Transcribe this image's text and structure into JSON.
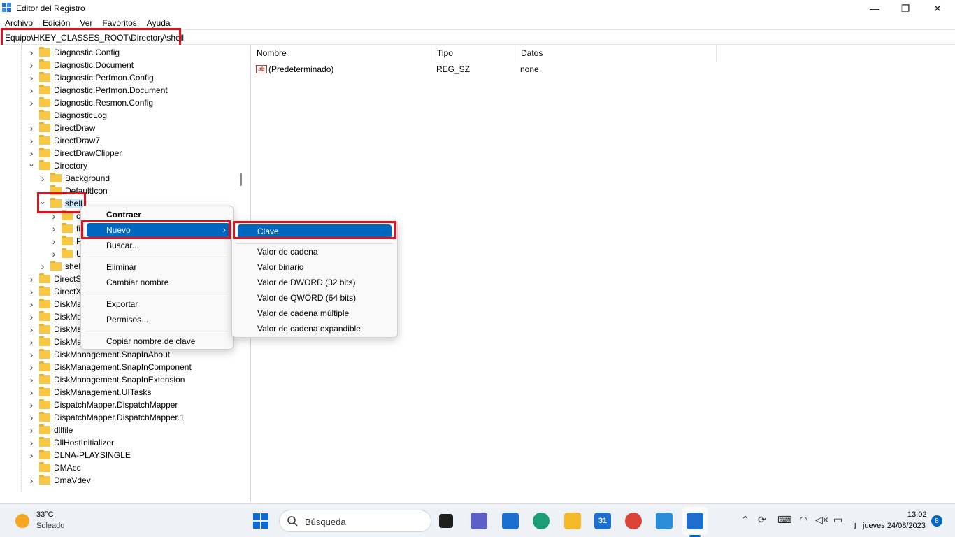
{
  "window": {
    "title": "Editor del Registro",
    "minimize": "—",
    "maximize": "❐",
    "close": "✕"
  },
  "menu": [
    "Archivo",
    "Edición",
    "Ver",
    "Favoritos",
    "Ayuda"
  ],
  "address": "Equipo\\HKEY_CLASSES_ROOT\\Directory\\shell",
  "tree": {
    "rows": [
      {
        "label": "Diagnostic.Config",
        "level": 0,
        "expander": "collapsed"
      },
      {
        "label": "Diagnostic.Document",
        "level": 0,
        "expander": "collapsed"
      },
      {
        "label": "Diagnostic.Perfmon.Config",
        "level": 0,
        "expander": "collapsed"
      },
      {
        "label": "Diagnostic.Perfmon.Document",
        "level": 0,
        "expander": "collapsed"
      },
      {
        "label": "Diagnostic.Resmon.Config",
        "level": 0,
        "expander": "collapsed"
      },
      {
        "label": "DiagnosticLog",
        "level": 0,
        "expander": "none"
      },
      {
        "label": "DirectDraw",
        "level": 0,
        "expander": "collapsed"
      },
      {
        "label": "DirectDraw7",
        "level": 0,
        "expander": "collapsed"
      },
      {
        "label": "DirectDrawClipper",
        "level": 0,
        "expander": "collapsed"
      },
      {
        "label": "Directory",
        "level": 0,
        "expander": "expanded"
      },
      {
        "label": "Background",
        "level": 1,
        "expander": "collapsed"
      },
      {
        "label": "DefaultIcon",
        "level": 1,
        "expander": "none"
      },
      {
        "label": "shell",
        "level": 1,
        "expander": "expanded",
        "selected": true
      },
      {
        "label": "cı",
        "level": 2,
        "expander": "collapsed"
      },
      {
        "label": "fi",
        "level": 2,
        "expander": "collapsed"
      },
      {
        "label": "P",
        "level": 2,
        "expander": "collapsed"
      },
      {
        "label": "U",
        "level": 2,
        "expander": "collapsed"
      },
      {
        "label": "shell",
        "level": 1,
        "expander": "collapsed"
      },
      {
        "label": "DirectSh",
        "level": 0,
        "expander": "collapsed"
      },
      {
        "label": "DirectXl",
        "level": 0,
        "expander": "collapsed"
      },
      {
        "label": "DiskMa",
        "level": 0,
        "expander": "collapsed"
      },
      {
        "label": "DiskMa",
        "level": 0,
        "expander": "collapsed"
      },
      {
        "label": "DiskMa",
        "level": 0,
        "expander": "collapsed"
      },
      {
        "label": "DiskMa",
        "level": 0,
        "expander": "collapsed"
      },
      {
        "label": "DiskManagement.SnapInAbout",
        "level": 0,
        "expander": "collapsed"
      },
      {
        "label": "DiskManagement.SnapInComponent",
        "level": 0,
        "expander": "collapsed"
      },
      {
        "label": "DiskManagement.SnapInExtension",
        "level": 0,
        "expander": "collapsed"
      },
      {
        "label": "DiskManagement.UITasks",
        "level": 0,
        "expander": "collapsed"
      },
      {
        "label": "DispatchMapper.DispatchMapper",
        "level": 0,
        "expander": "collapsed"
      },
      {
        "label": "DispatchMapper.DispatchMapper.1",
        "level": 0,
        "expander": "collapsed"
      },
      {
        "label": "dllfile",
        "level": 0,
        "expander": "collapsed"
      },
      {
        "label": "DllHostInitializer",
        "level": 0,
        "expander": "collapsed"
      },
      {
        "label": "DLNA-PLAYSINGLE",
        "level": 0,
        "expander": "collapsed"
      },
      {
        "label": "DMAcc",
        "level": 0,
        "expander": "none"
      },
      {
        "label": "DmaVdev",
        "level": 0,
        "expander": "collapsed"
      }
    ]
  },
  "list": {
    "columns": [
      "Nombre",
      "Tipo",
      "Datos"
    ],
    "rows": [
      {
        "name": "(Predeterminado)",
        "type": "REG_SZ",
        "data": "none",
        "icon": "ab-string-icon",
        "icon_text": "ab"
      }
    ]
  },
  "context_menu": {
    "items": [
      "Contraer",
      "Nuevo",
      "Buscar...",
      "Eliminar",
      "Cambiar nombre",
      "Exportar",
      "Permisos...",
      "Copiar nombre de clave"
    ],
    "submenu_arrow": "›"
  },
  "submenu": {
    "items": [
      "Clave",
      "Valor de cadena",
      "Valor binario",
      "Valor de DWORD (32 bits)",
      "Valor de QWORD (64 bits)",
      "Valor de cadena múltiple",
      "Valor de cadena expandible"
    ]
  },
  "taskbar": {
    "weather_temp": "33°C",
    "weather_desc": "Soleado",
    "search_placeholder": "Búsqueda",
    "calendar_day": "31",
    "time": "13:02",
    "date": "jueves 24/08/2023",
    "date_prefix": "j",
    "notification_count": "8"
  },
  "colors": {
    "highlight": "#0067c0",
    "annotation": "#e2101d",
    "folder": "#f7c844"
  }
}
